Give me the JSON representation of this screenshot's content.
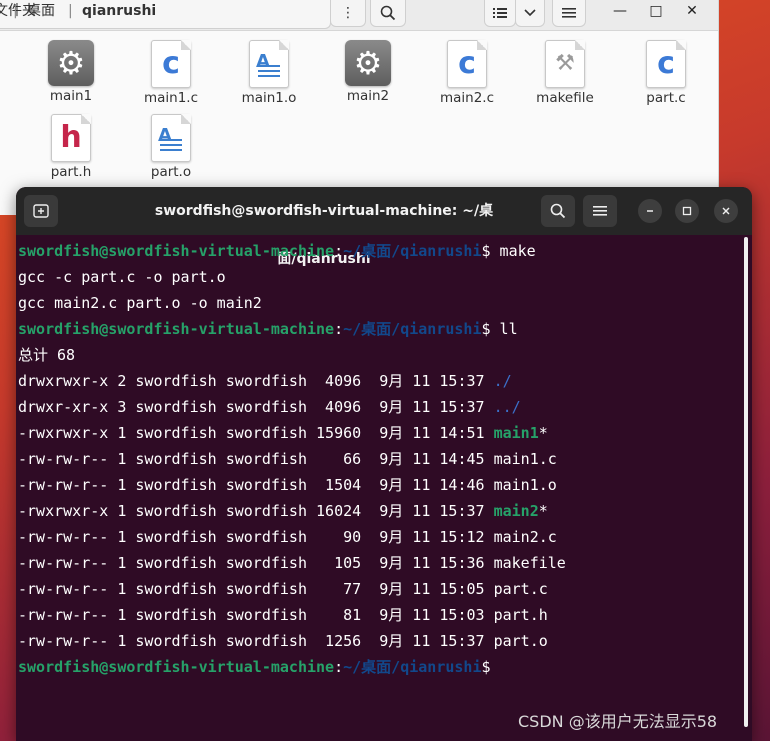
{
  "file_manager": {
    "breadcrumb": {
      "prefix": "主文件夹",
      "segment1": "桌面",
      "segment2": "qianrushi"
    },
    "buttons": {
      "menu": "⋮",
      "search": "🔍",
      "list_view": "☰",
      "dropdown": "⌄",
      "hamburger": "≡"
    },
    "window_controls": {
      "minimize": "—",
      "maximize": "□",
      "close": "✕"
    },
    "files": [
      {
        "name": "main1",
        "kind": "executable"
      },
      {
        "name": "main1.c",
        "kind": "c-source"
      },
      {
        "name": "main1.o",
        "kind": "object"
      },
      {
        "name": "main2",
        "kind": "executable"
      },
      {
        "name": "main2.c",
        "kind": "c-source"
      },
      {
        "name": "makefile",
        "kind": "makefile"
      },
      {
        "name": "part.c",
        "kind": "c-source"
      },
      {
        "name": "part.h",
        "kind": "header"
      },
      {
        "name": "part.o",
        "kind": "object"
      }
    ]
  },
  "terminal": {
    "title": "swordfish@swordfish-virtual-machine: ~/桌面/qianrushi",
    "prompt_user": "swordfish@swordfish-virtual-machine",
    "prompt_path": "~/桌面/qianrushi",
    "cmd1": "make",
    "out1": "gcc -c part.c -o part.o",
    "out2": "gcc main2.c part.o -o main2",
    "cmd2": "ll",
    "total": "总计 68",
    "listing": [
      {
        "meta": "drwxrwxr-x 2 swordfish swordfish  4096  9月 11 15:37 ",
        "name": "./",
        "suffix": ""
      },
      {
        "meta": "drwxr-xr-x 3 swordfish swordfish  4096  9月 11 15:37 ",
        "name": "../",
        "suffix": ""
      },
      {
        "meta": "-rwxrwxr-x 1 swordfish swordfish 15960  9月 11 14:51 ",
        "name": "main1",
        "suffix": "*"
      },
      {
        "meta": "-rw-rw-r-- 1 swordfish swordfish    66  9月 11 14:45 ",
        "name": "main1.c",
        "suffix": ""
      },
      {
        "meta": "-rw-rw-r-- 1 swordfish swordfish  1504  9月 11 14:46 ",
        "name": "main1.o",
        "suffix": ""
      },
      {
        "meta": "-rwxrwxr-x 1 swordfish swordfish 16024  9月 11 15:37 ",
        "name": "main2",
        "suffix": "*"
      },
      {
        "meta": "-rw-rw-r-- 1 swordfish swordfish    90  9月 11 15:12 ",
        "name": "main2.c",
        "suffix": ""
      },
      {
        "meta": "-rw-rw-r-- 1 swordfish swordfish   105  9月 11 15:36 ",
        "name": "makefile",
        "suffix": ""
      },
      {
        "meta": "-rw-rw-r-- 1 swordfish swordfish    77  9月 11 15:05 ",
        "name": "part.c",
        "suffix": ""
      },
      {
        "meta": "-rw-rw-r-- 1 swordfish swordfish    81  9月 11 15:03 ",
        "name": "part.h",
        "suffix": ""
      },
      {
        "meta": "-rw-rw-r-- 1 swordfish swordfish  1256  9月 11 15:37 ",
        "name": "part.o",
        "suffix": ""
      }
    ]
  },
  "watermark": "CSDN @该用户无法显示58",
  "colors": {
    "prompt_user": "#26a269",
    "prompt_path": "#12488b",
    "terminal_bg": "#2f0b25"
  }
}
